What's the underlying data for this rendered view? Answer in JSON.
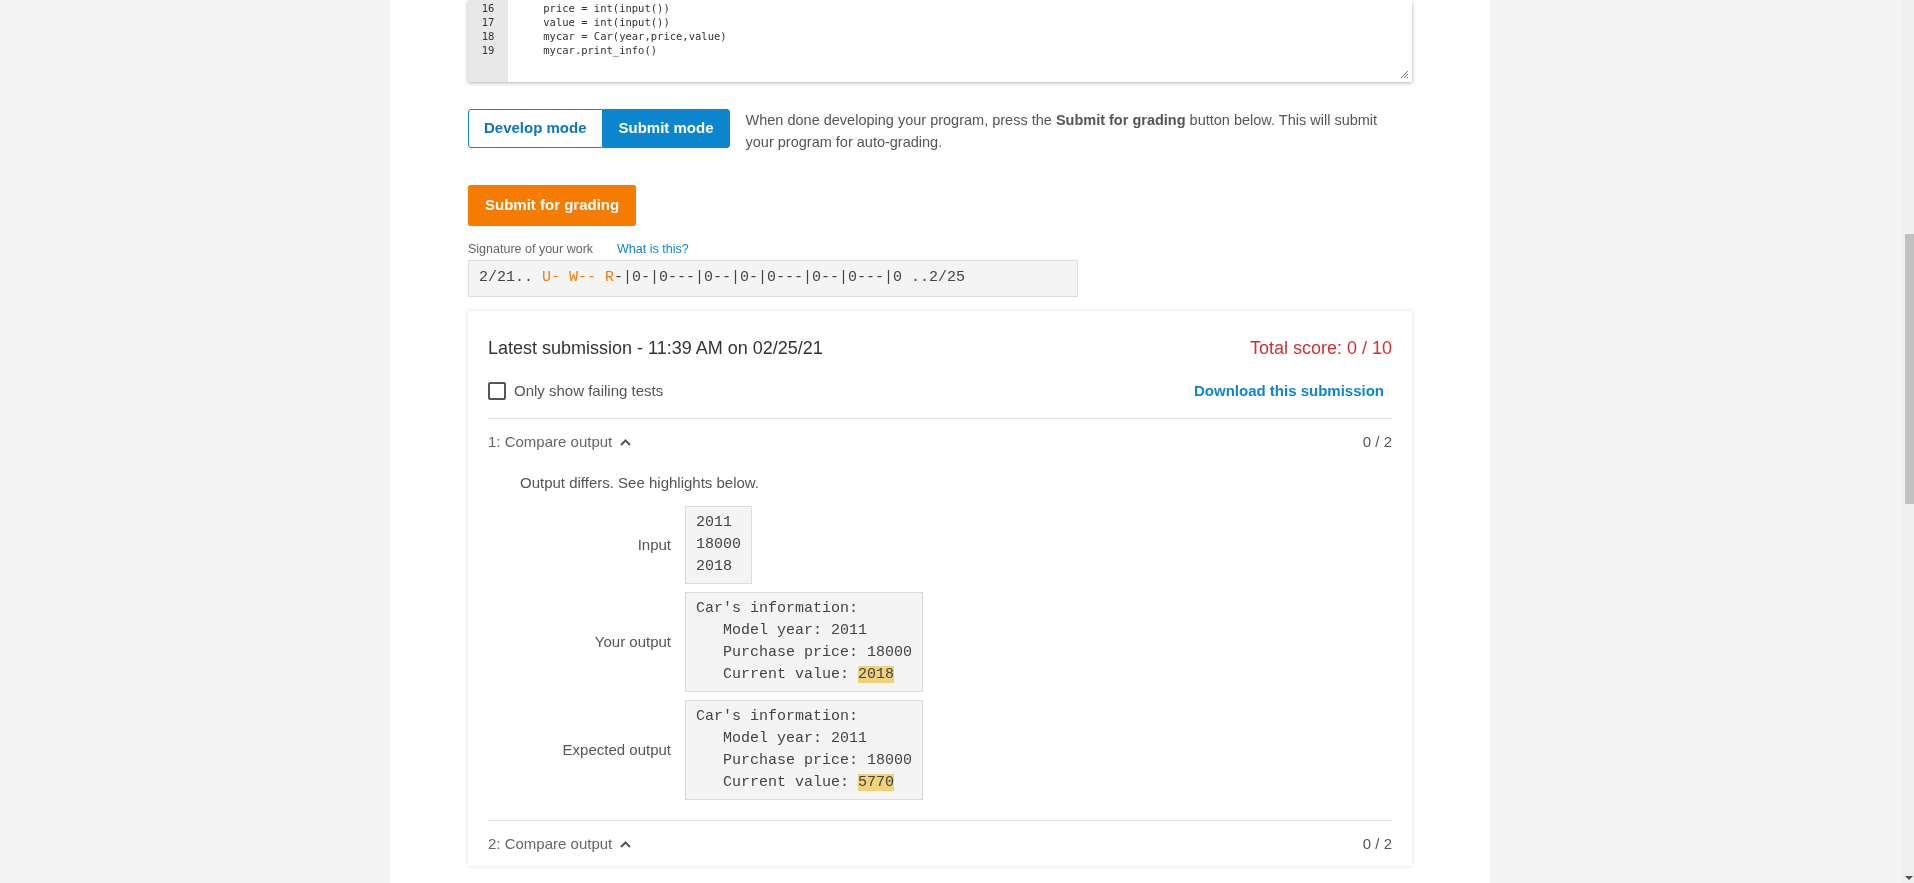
{
  "editor": {
    "lines": [
      {
        "number": "16",
        "code": "    price = int(input())"
      },
      {
        "number": "17",
        "code": "    value = int(input())"
      },
      {
        "number": "18",
        "code": "    mycar = Car(year,price,value)"
      },
      {
        "number": "19",
        "code": "    mycar.print_info()"
      }
    ]
  },
  "modes": [
    {
      "label": "Develop mode",
      "selected": false
    },
    {
      "label": "Submit mode",
      "selected": true
    }
  ],
  "mode_hint": "When done developing your program, press the **Submit for grading** button below. This will submit your program for auto-grading.",
  "submit_button": "Submit for grading",
  "signature": {
    "label": "Signature of your work",
    "help_link": "What is this?",
    "segments": [
      {
        "text": "2/21.. ",
        "highlighted": false
      },
      {
        "text": "U- ",
        "highlighted": true
      },
      {
        "text": "W-- ",
        "highlighted": true
      },
      {
        "text": "R",
        "highlighted": true
      },
      {
        "text": "-|0-|0---|0--|0-|0---|0--|0---|0 ..2/25",
        "highlighted": false
      }
    ]
  },
  "submission": {
    "title": "Latest submission - 11:39 AM on 02/25/21",
    "total_score": "Total score: 0 / 10",
    "filter": {
      "label": "Only show failing tests",
      "checked": false
    },
    "download_link": "Download this submission",
    "tests": [
      {
        "title": "1: Compare output",
        "score": "0 / 2",
        "expanded": true,
        "message": "Output differs. See highlights below.",
        "rows": [
          {
            "label": "Input",
            "lines": [
              {
                "text": "2011"
              },
              {
                "text": "18000"
              },
              {
                "text": "2018"
              }
            ]
          },
          {
            "label": "Your output",
            "lines": [
              {
                "text": "Car's information:"
              },
              {
                "text": "   Model year: 2011"
              },
              {
                "text": "   Purchase price: 18000"
              },
              {
                "text": "   Current value: ",
                "highlight": "2018"
              }
            ]
          },
          {
            "label": "Expected output",
            "lines": [
              {
                "text": "Car's information:"
              },
              {
                "text": "   Model year: 2011"
              },
              {
                "text": "   Purchase price: 18000"
              },
              {
                "text": "   Current value: ",
                "highlight": "5770"
              }
            ]
          }
        ]
      },
      {
        "title": "2: Compare output",
        "score": "0 / 2",
        "expanded": true
      }
    ]
  }
}
